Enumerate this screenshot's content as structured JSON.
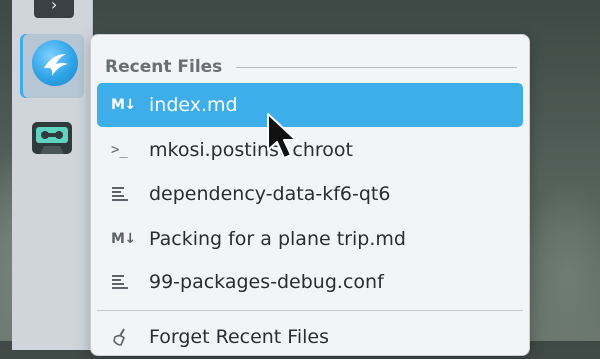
{
  "panel": {
    "apps": [
      {
        "name": "terminal",
        "icon": "terminal-icon"
      },
      {
        "name": "plasma",
        "icon": "plasma-logo-icon"
      },
      {
        "name": "cassette",
        "icon": "cassette-tape-icon"
      }
    ]
  },
  "menu": {
    "section_title": "Recent Files",
    "items": [
      {
        "label": "index.md",
        "icon": "markdown-icon",
        "glyph": "M↓",
        "selected": true
      },
      {
        "label": "mkosi.postinst.chroot",
        "icon": "terminal-script-icon",
        "glyph": ">_",
        "selected": false
      },
      {
        "label": "dependency-data-kf6-qt6",
        "icon": "text-file-icon",
        "glyph": "",
        "selected": false
      },
      {
        "label": "Packing for a plane trip.md",
        "icon": "markdown-icon",
        "glyph": "M↓",
        "selected": false
      },
      {
        "label": "99-packages-debug.conf",
        "icon": "text-file-icon",
        "glyph": "",
        "selected": false
      }
    ],
    "forget_label": "Forget Recent Files"
  },
  "colors": {
    "accent": "#3daee9",
    "menu_bg": "#f3f4f5",
    "panel_bg": "#cfd5da"
  }
}
